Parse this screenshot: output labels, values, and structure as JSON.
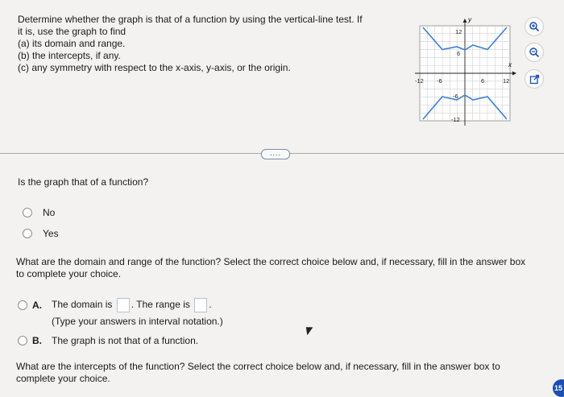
{
  "question": {
    "line1": "Determine whether the graph is that of a function by using the vertical-line test.  If",
    "line2": "it is, use the graph to find",
    "line3": "(a) its domain and range.",
    "line4": "(b) the intercepts, if any.",
    "line5": "(c) any symmetry with respect to the x-axis, y-axis, or the origin."
  },
  "graph": {
    "y_axis_label": "y",
    "x_axis_label": "x",
    "tick_y_top": "12",
    "tick_y_upper": "6",
    "tick_y_lower": "-6",
    "tick_y_bottom": "-12",
    "tick_x_left": "-12",
    "tick_x_mid_left": "-6",
    "tick_x_mid_right": "6",
    "tick_x_right": "12"
  },
  "tools": {
    "zoom_in": "zoom-in-icon",
    "zoom_out": "zoom-out-icon",
    "popout": "external-link-icon"
  },
  "expand_dots": "....",
  "part1": {
    "prompt": "Is the graph that of a function?",
    "options": [
      "No",
      "Yes"
    ]
  },
  "part2": {
    "prompt_line1": "What are the domain and range of the function? Select the correct choice below and, if necessary, fill in the answer box",
    "prompt_line2": "to complete your choice.",
    "option_a_letter": "A.",
    "option_a_pre": "The domain is",
    "option_a_mid": ". The range is",
    "option_a_post": ".",
    "option_a_note": "(Type your answers in interval notation.)",
    "option_b_letter": "B.",
    "option_b_text": "The graph is not that of a function."
  },
  "part3": {
    "prompt_line1": "What are the intercepts of the function? Select the correct choice below and, if necessary, fill in the answer box to",
    "prompt_line2": "complete your choice."
  },
  "badge": "15",
  "colors": {
    "accent": "#1c4fb3",
    "curve": "#3d7fd1",
    "divider": "#9fa9b0"
  }
}
